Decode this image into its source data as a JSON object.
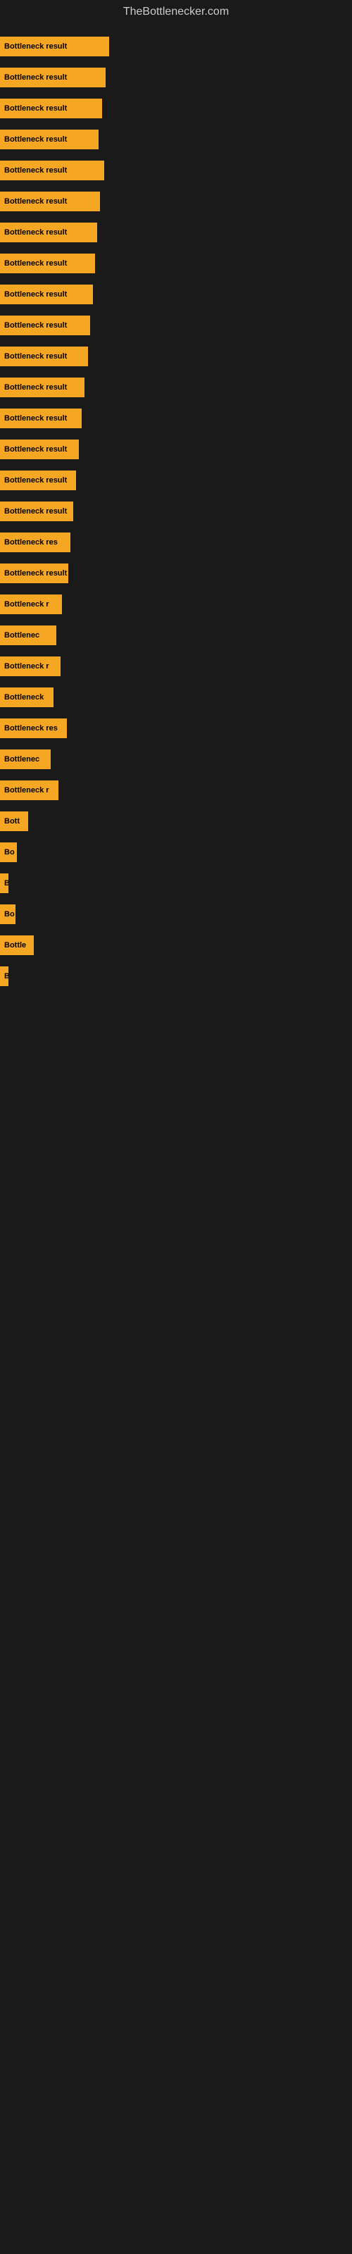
{
  "site": {
    "title": "TheBottlenecker.com"
  },
  "bars": [
    {
      "id": 1,
      "label": "Bottleneck result",
      "width": 155
    },
    {
      "id": 2,
      "label": "Bottleneck result",
      "width": 150
    },
    {
      "id": 3,
      "label": "Bottleneck result",
      "width": 145
    },
    {
      "id": 4,
      "label": "Bottleneck result",
      "width": 140
    },
    {
      "id": 5,
      "label": "Bottleneck result",
      "width": 148
    },
    {
      "id": 6,
      "label": "Bottleneck result",
      "width": 142
    },
    {
      "id": 7,
      "label": "Bottleneck result",
      "width": 138
    },
    {
      "id": 8,
      "label": "Bottleneck result",
      "width": 135
    },
    {
      "id": 9,
      "label": "Bottleneck result",
      "width": 132
    },
    {
      "id": 10,
      "label": "Bottleneck result",
      "width": 128
    },
    {
      "id": 11,
      "label": "Bottleneck result",
      "width": 125
    },
    {
      "id": 12,
      "label": "Bottleneck result",
      "width": 120
    },
    {
      "id": 13,
      "label": "Bottleneck result",
      "width": 116
    },
    {
      "id": 14,
      "label": "Bottleneck result",
      "width": 112
    },
    {
      "id": 15,
      "label": "Bottleneck result",
      "width": 108
    },
    {
      "id": 16,
      "label": "Bottleneck result",
      "width": 104
    },
    {
      "id": 17,
      "label": "Bottleneck res",
      "width": 100
    },
    {
      "id": 18,
      "label": "Bottleneck result",
      "width": 97
    },
    {
      "id": 19,
      "label": "Bottleneck r",
      "width": 88
    },
    {
      "id": 20,
      "label": "Bottlenec",
      "width": 80
    },
    {
      "id": 21,
      "label": "Bottleneck r",
      "width": 86
    },
    {
      "id": 22,
      "label": "Bottleneck",
      "width": 76
    },
    {
      "id": 23,
      "label": "Bottleneck res",
      "width": 95
    },
    {
      "id": 24,
      "label": "Bottlenec",
      "width": 72
    },
    {
      "id": 25,
      "label": "Bottleneck r",
      "width": 83
    },
    {
      "id": 26,
      "label": "Bott",
      "width": 40
    },
    {
      "id": 27,
      "label": "Bo",
      "width": 24
    },
    {
      "id": 28,
      "label": "B",
      "width": 12
    },
    {
      "id": 29,
      "label": "Bo",
      "width": 22
    },
    {
      "id": 30,
      "label": "Bottle",
      "width": 48
    },
    {
      "id": 31,
      "label": "B",
      "width": 10
    }
  ]
}
